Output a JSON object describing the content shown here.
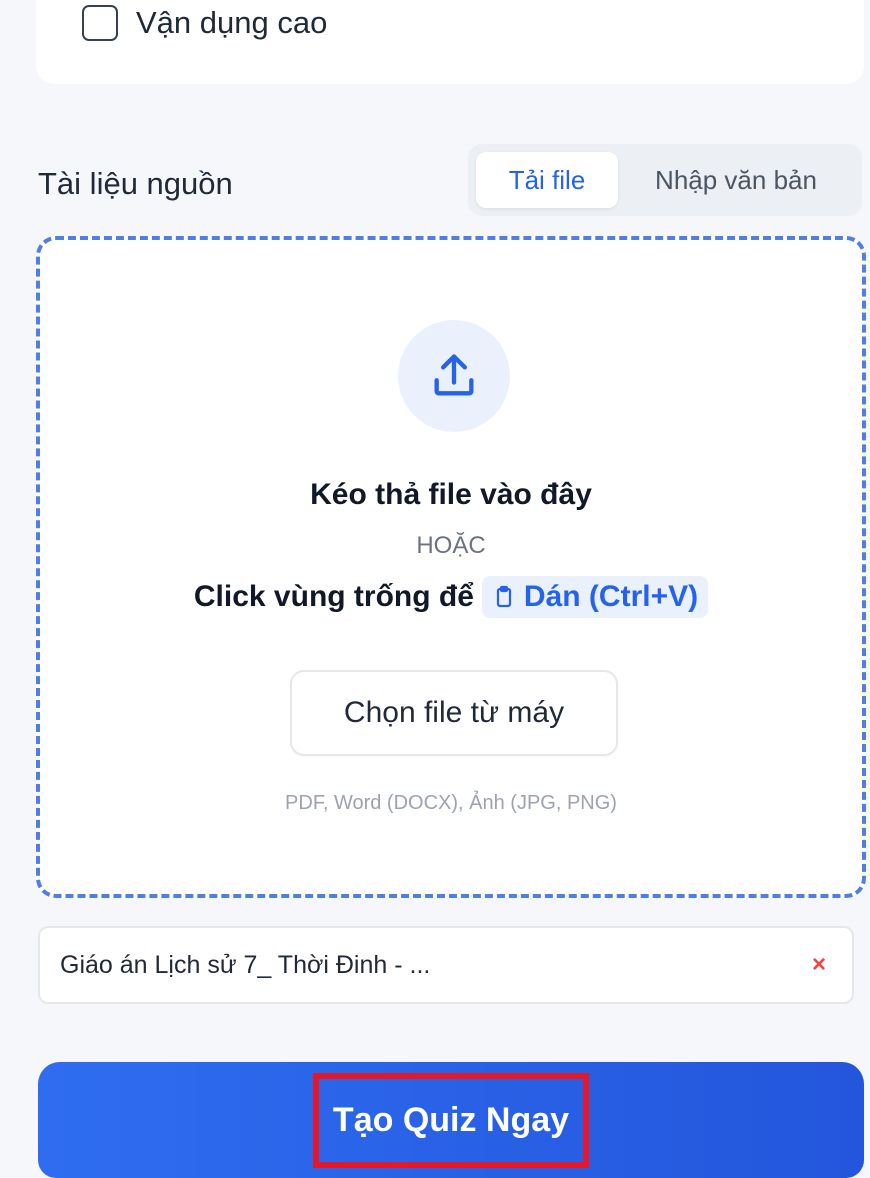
{
  "level_option": {
    "label": "Vận dụng cao",
    "checked": false
  },
  "source": {
    "title": "Tài liệu nguồn",
    "tabs": [
      {
        "label": "Tải file",
        "active": true
      },
      {
        "label": "Nhập văn bản",
        "active": false
      }
    ]
  },
  "dropzone": {
    "icon": "upload-icon",
    "title": "Kéo thả file vào đây",
    "or_text": "HOẶC",
    "paste_lead": "Click vùng trống để",
    "paste_button": "Dán (Ctrl+V)",
    "paste_icon": "clipboard-icon",
    "choose_button": "Chọn file từ máy",
    "formats": "PDF, Word (DOCX), Ảnh (JPG, PNG)"
  },
  "attached_file": {
    "name": "Giáo án Lịch sử 7_ Thời Đinh - ...",
    "remove": "×"
  },
  "submit": {
    "label": "Tạo Quiz Ngay"
  },
  "colors": {
    "accent": "#2563eb",
    "highlight_box": "#e3192b",
    "danger": "#ef4444"
  }
}
